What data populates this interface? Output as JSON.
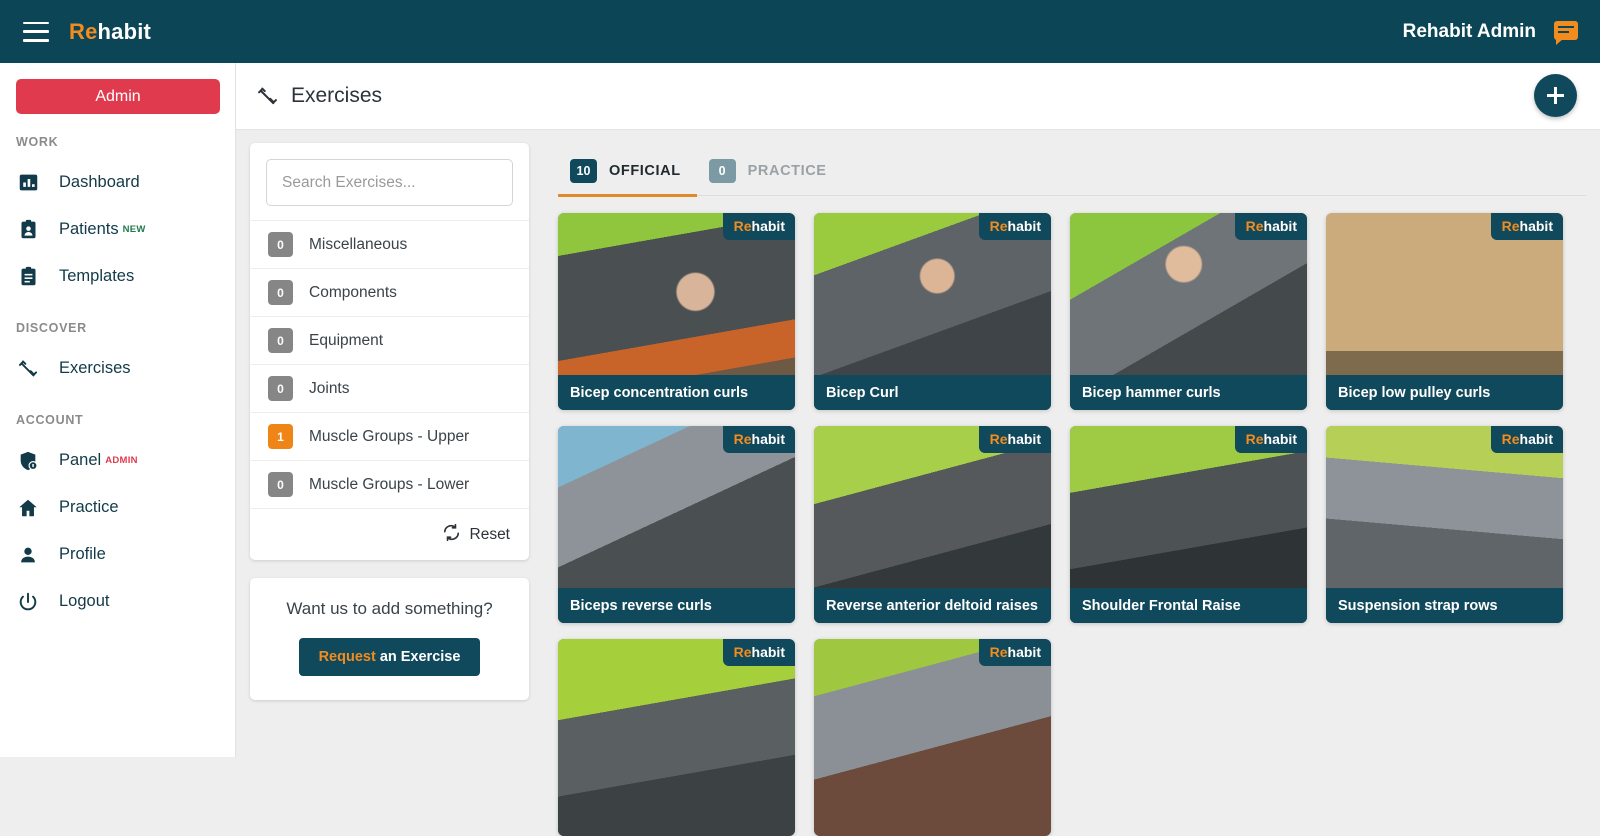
{
  "topbar": {
    "brand_prefix": "Re",
    "brand_suffix": "habit",
    "admin_name": "Rehabit Admin",
    "menu_icon": "hamburger-menu-icon",
    "chat_icon": "chat-bubble-icon"
  },
  "sidebar": {
    "admin_button": "Admin",
    "sections": [
      {
        "title": "WORK",
        "items": [
          {
            "label": "Dashboard",
            "icon": "chart-bar-icon",
            "badge": ""
          },
          {
            "label": "Patients",
            "icon": "patient-card-icon",
            "badge": "NEW",
            "badge_type": "new"
          },
          {
            "label": "Templates",
            "icon": "clipboard-icon",
            "badge": ""
          }
        ]
      },
      {
        "title": "DISCOVER",
        "items": [
          {
            "label": "Exercises",
            "icon": "dumbbell-icon",
            "badge": ""
          }
        ]
      },
      {
        "title": "ACCOUNT",
        "items": [
          {
            "label": "Panel",
            "icon": "shield-icon",
            "badge": "ADMIN",
            "badge_type": "admin"
          },
          {
            "label": "Practice",
            "icon": "home-icon",
            "badge": ""
          },
          {
            "label": "Profile",
            "icon": "person-icon",
            "badge": ""
          },
          {
            "label": "Logout",
            "icon": "power-icon",
            "badge": ""
          }
        ]
      }
    ]
  },
  "page": {
    "title": "Exercises",
    "title_icon": "dumbbell-icon",
    "add_button": "+"
  },
  "search": {
    "placeholder": "Search Exercises...",
    "value": ""
  },
  "filters": {
    "rows": [
      {
        "count": "0",
        "label": "Miscellaneous",
        "active": false
      },
      {
        "count": "0",
        "label": "Components",
        "active": false
      },
      {
        "count": "0",
        "label": "Equipment",
        "active": false
      },
      {
        "count": "0",
        "label": "Joints",
        "active": false
      },
      {
        "count": "1",
        "label": "Muscle Groups - Upper",
        "active": true
      },
      {
        "count": "0",
        "label": "Muscle Groups - Lower",
        "active": false
      }
    ],
    "reset_label": "Reset",
    "reset_icon": "refresh-icon"
  },
  "promo": {
    "title": "Want us to add something?",
    "button_word1": "Request",
    "button_word2": "an Exercise"
  },
  "tabs": [
    {
      "count": "10",
      "label": "OFFICIAL",
      "active": true
    },
    {
      "count": "0",
      "label": "PRACTICE",
      "active": false
    }
  ],
  "watermark": {
    "prefix": "Re",
    "suffix": "habit"
  },
  "exercises": [
    {
      "title": "Bicep concentration curls"
    },
    {
      "title": "Bicep Curl"
    },
    {
      "title": "Bicep hammer curls"
    },
    {
      "title": "Bicep low pulley curls"
    },
    {
      "title": "Biceps reverse curls"
    },
    {
      "title": "Reverse anterior deltoid raises"
    },
    {
      "title": "Shoulder Frontal Raise"
    },
    {
      "title": "Suspension strap rows"
    },
    {
      "title": ""
    },
    {
      "title": ""
    }
  ],
  "colors": {
    "header_teal": "#0b4556",
    "card_teal": "#11495c",
    "accent_orange": "#f28c1e",
    "admin_red": "#e03a4e",
    "badge_gray": "#868686",
    "new_green": "#1f7a4d",
    "tab_underline": "#e08b2b",
    "page_bg": "#eeeeee"
  }
}
